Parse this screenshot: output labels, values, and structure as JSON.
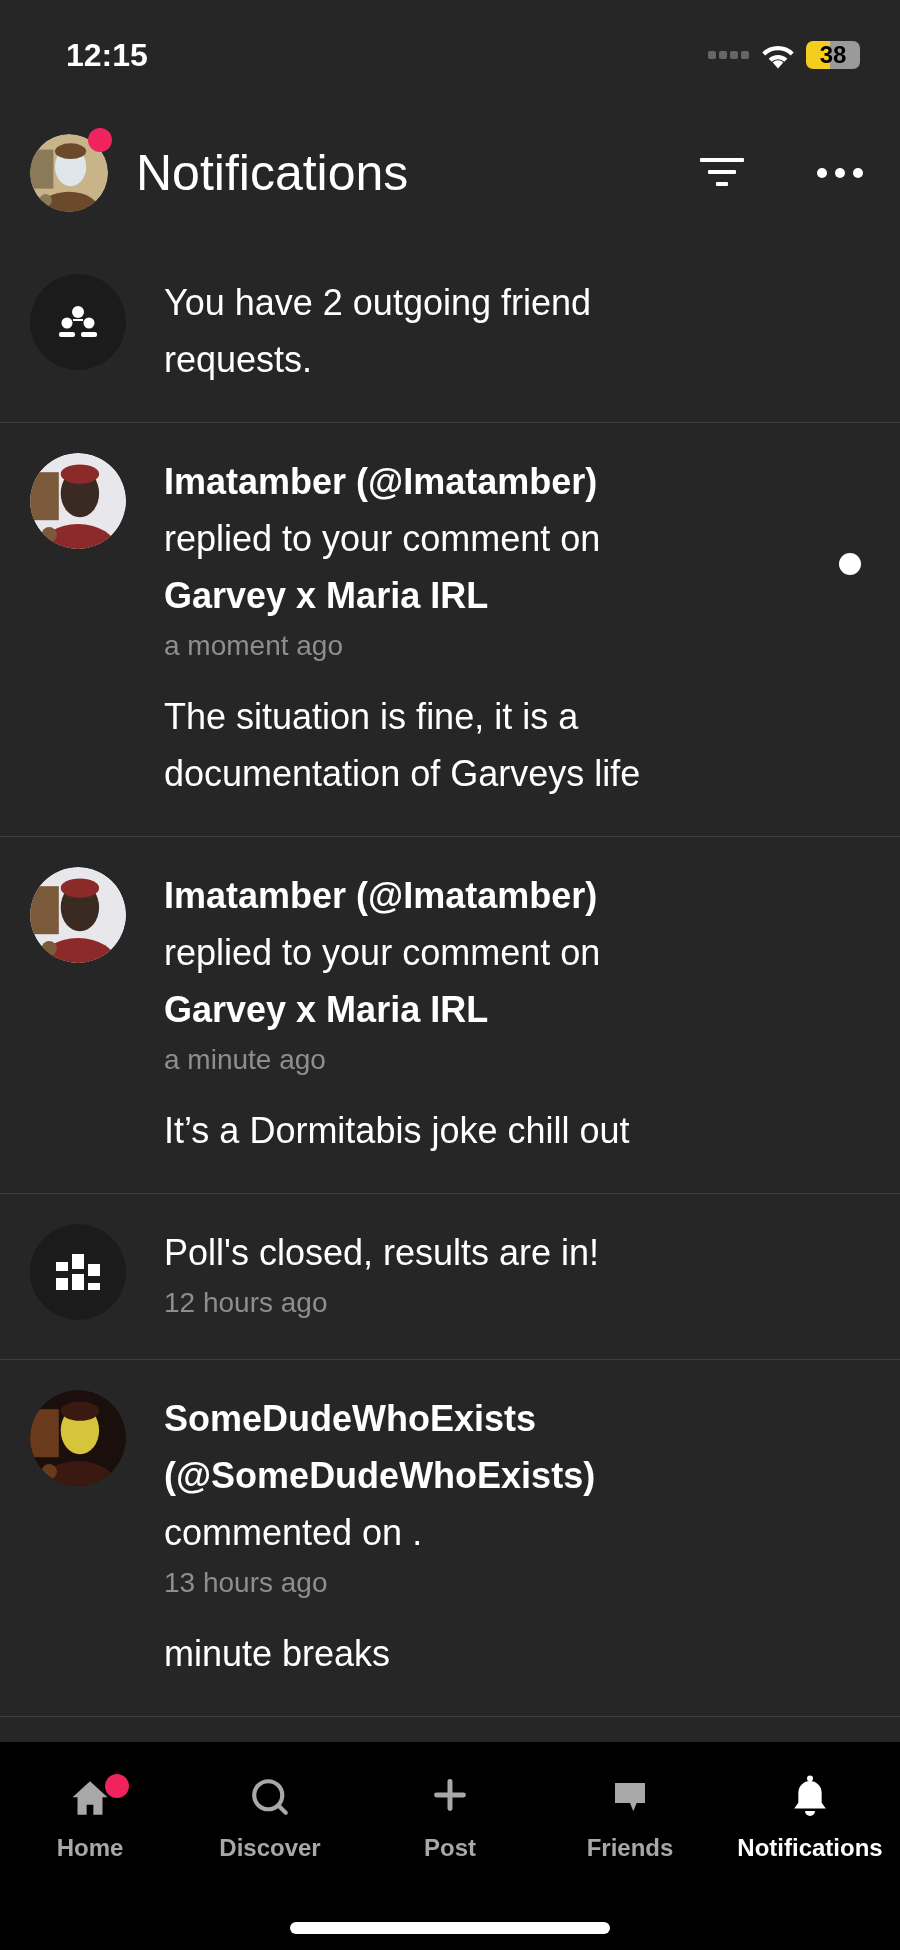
{
  "status_bar": {
    "time": "12:15",
    "battery": "38"
  },
  "header": {
    "title": "Notifications",
    "avatar_badge": true
  },
  "notifications": [
    {
      "kind": "group",
      "text": "You have 2 outgoing friend requests."
    },
    {
      "kind": "user",
      "author": "Imatamber (@Imatamber)",
      "action": "replied to your comment on",
      "target": "Garvey x Maria IRL",
      "time": "a moment ago",
      "body": "The situation is fine, it is a documentation of Garveys life",
      "unread": true
    },
    {
      "kind": "user",
      "author": "Imatamber (@Imatamber)",
      "action": "replied to your comment on",
      "target": "Garvey x Maria IRL",
      "time": "a minute ago",
      "body": "It’s a Dormitabis joke chill out",
      "unread": false
    },
    {
      "kind": "poll",
      "text": "Poll's closed, results are in!",
      "time": "12 hours ago"
    },
    {
      "kind": "user",
      "author": "SomeDudeWhoExists (@SomeDudeWhoExists)",
      "action": "commented on .",
      "time": "13 hours ago",
      "body": "minute breaks",
      "unread": false
    }
  ],
  "nav": [
    {
      "label": "Home",
      "selected": false,
      "badge": true
    },
    {
      "label": "Discover",
      "selected": false,
      "badge": false
    },
    {
      "label": "Post",
      "selected": false,
      "badge": false
    },
    {
      "label": "Friends",
      "selected": false,
      "badge": false
    },
    {
      "label": "Notifications",
      "selected": true,
      "badge": false
    }
  ]
}
